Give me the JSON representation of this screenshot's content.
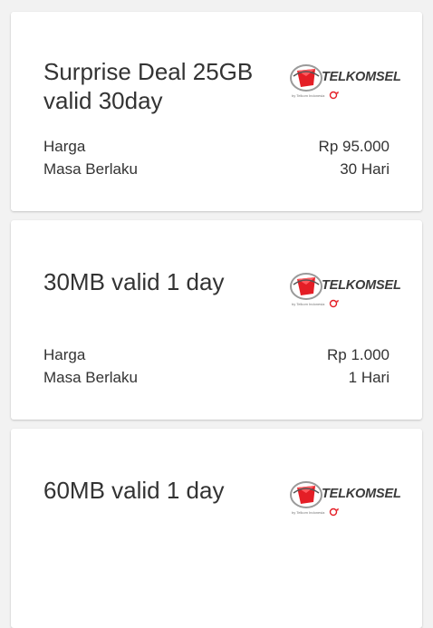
{
  "cards": [
    {
      "title": "Surprise Deal 25GB valid 30day",
      "provider": "TELKOMSEL",
      "provider_sub": "by Telkom Indonesia",
      "price_label": "Harga",
      "price_value": "Rp 95.000",
      "validity_label": "Masa Berlaku",
      "validity_value": "30 Hari"
    },
    {
      "title": "30MB valid 1 day",
      "provider": "TELKOMSEL",
      "provider_sub": "by Telkom Indonesia",
      "price_label": "Harga",
      "price_value": "Rp 1.000",
      "validity_label": "Masa Berlaku",
      "validity_value": "1 Hari"
    },
    {
      "title": "60MB valid 1 day",
      "provider": "TELKOMSEL",
      "provider_sub": "by Telkom Indonesia",
      "price_label": "",
      "price_value": "",
      "validity_label": "",
      "validity_value": ""
    }
  ],
  "colors": {
    "brand_red": "#e41e26",
    "text": "#333333",
    "background": "#f2f2f2",
    "card": "#ffffff"
  }
}
